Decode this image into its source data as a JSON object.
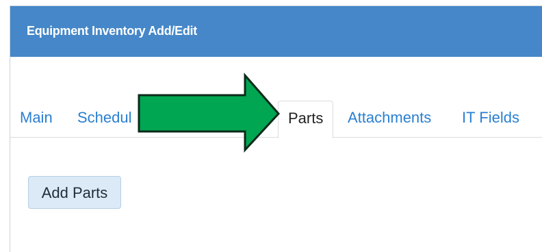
{
  "dialog": {
    "title": "Equipment Inventory Add/Edit"
  },
  "tabs": [
    {
      "label": "Main",
      "active": false
    },
    {
      "label": "Schedul",
      "active": false
    },
    {
      "label": "Parts",
      "active": true
    },
    {
      "label": "Attachments",
      "active": false
    },
    {
      "label": "IT Fields",
      "active": false
    }
  ],
  "parts_panel": {
    "add_button_label": "Add Parts"
  },
  "colors": {
    "header_bg": "#4587c8",
    "tab_link": "#2a7fd0",
    "arrow_fill": "#00a651",
    "arrow_stroke": "#0b2a1a",
    "button_bg": "#dbeaf6"
  },
  "annotation": {
    "icon": "right-arrow-icon",
    "points_to": "Parts"
  }
}
